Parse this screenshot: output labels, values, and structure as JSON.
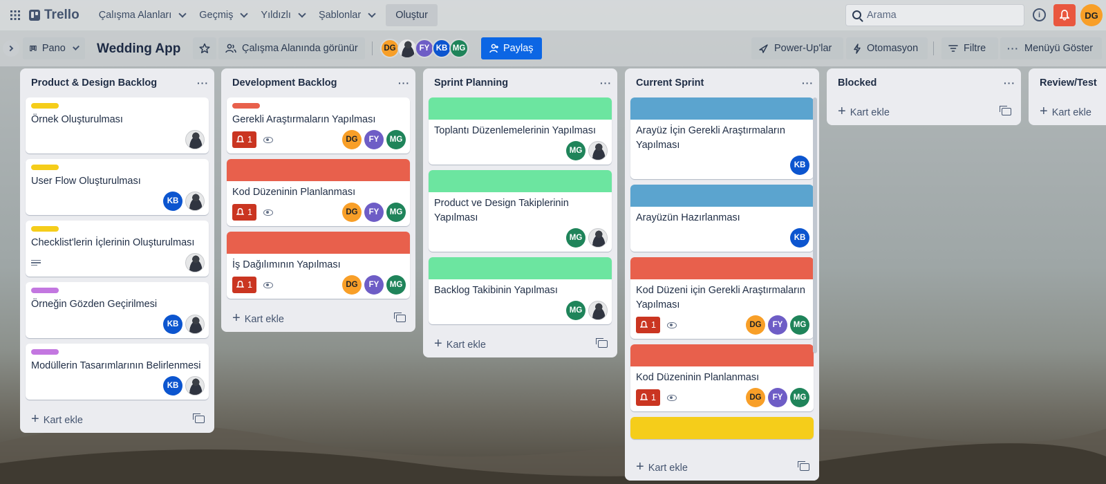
{
  "topbar": {
    "logo": "Trello",
    "nav": [
      "Çalışma Alanları",
      "Geçmiş",
      "Yıldızlı",
      "Şablonlar"
    ],
    "create": "Oluştur",
    "search_placeholder": "Arama",
    "user_initials": "DG"
  },
  "board": {
    "view": "Pano",
    "title": "Wedding App",
    "visibility": "Çalışma Alanında görünür",
    "members": [
      "DG",
      "photo",
      "FY",
      "KB",
      "MG"
    ],
    "share": "Paylaş",
    "powerups": "Power-Up'lar",
    "automation": "Otomasyon",
    "filter": "Filtre",
    "menu": "Menüyü Göster"
  },
  "colors": {
    "yellow": "#f5cd1a",
    "purple": "#c377e0",
    "red": "#e8604c",
    "green": "#6ce5a0",
    "blue": "#5ba4cf",
    "share": "#0c66e4"
  },
  "add_card": "Kart ekle",
  "lists": [
    {
      "title": "Product & Design Backlog",
      "cards": [
        {
          "title": "Örnek Oluşturulması",
          "label": "yellow",
          "members": [
            "photo"
          ]
        },
        {
          "title": "User Flow Oluşturulması",
          "label": "yellow",
          "members": [
            "KB",
            "photo"
          ]
        },
        {
          "title": "Checklist'lerin İçlerinin Oluşturulması",
          "label": "yellow",
          "members": [
            "photo"
          ],
          "description": true
        },
        {
          "title": "Örneğin Gözden Geçirilmesi",
          "label": "purple",
          "members": [
            "KB",
            "photo"
          ]
        },
        {
          "title": "Modüllerin Tasarımlarının Belirlenmesi",
          "label": "purple",
          "members": [
            "KB",
            "photo"
          ]
        }
      ]
    },
    {
      "title": "Development Backlog",
      "cards": [
        {
          "title": "Gerekli Araştırmaların Yapılması",
          "label": "red",
          "notif": "1",
          "watch": true,
          "members": [
            "DG",
            "FY",
            "MG"
          ]
        },
        {
          "title": "Kod Düzeninin Planlanması",
          "cover": "red",
          "notif": "1",
          "watch": true,
          "members": [
            "DG",
            "FY",
            "MG"
          ]
        },
        {
          "title": "İş Dağılımının Yapılması",
          "cover": "red",
          "notif": "1",
          "watch": true,
          "members": [
            "DG",
            "FY",
            "MG"
          ]
        }
      ]
    },
    {
      "title": "Sprint Planning",
      "cards": [
        {
          "title": "Toplantı Düzenlemelerinin Yapılması",
          "cover": "green",
          "members": [
            "MG",
            "photo"
          ]
        },
        {
          "title": "Product ve Design Takiplerinin Yapılması",
          "cover": "green",
          "members": [
            "MG",
            "photo"
          ]
        },
        {
          "title": "Backlog Takibinin Yapılması",
          "cover": "green",
          "members": [
            "MG",
            "photo"
          ]
        }
      ]
    },
    {
      "title": "Current Sprint",
      "cards": [
        {
          "title": "Arayüz İçin Gerekli Araştırmaların Yapılması",
          "cover": "blue",
          "members": [
            "KB"
          ]
        },
        {
          "title": "Arayüzün Hazırlanması",
          "cover": "blue",
          "members": [
            "KB"
          ]
        },
        {
          "title": "Kod Düzeni için Gerekli Araştırmaların Yapılması",
          "cover": "red",
          "notif": "1",
          "watch": true,
          "members": [
            "DG",
            "FY",
            "MG"
          ]
        },
        {
          "title": "Kod Düzeninin Planlanması",
          "cover": "red",
          "notif": "1",
          "watch": true,
          "members": [
            "DG",
            "FY",
            "MG"
          ]
        },
        {
          "title": "",
          "cover": "yellow",
          "members": []
        }
      ]
    },
    {
      "title": "Blocked",
      "cards": []
    },
    {
      "title": "Review/Test",
      "cards": []
    }
  ]
}
